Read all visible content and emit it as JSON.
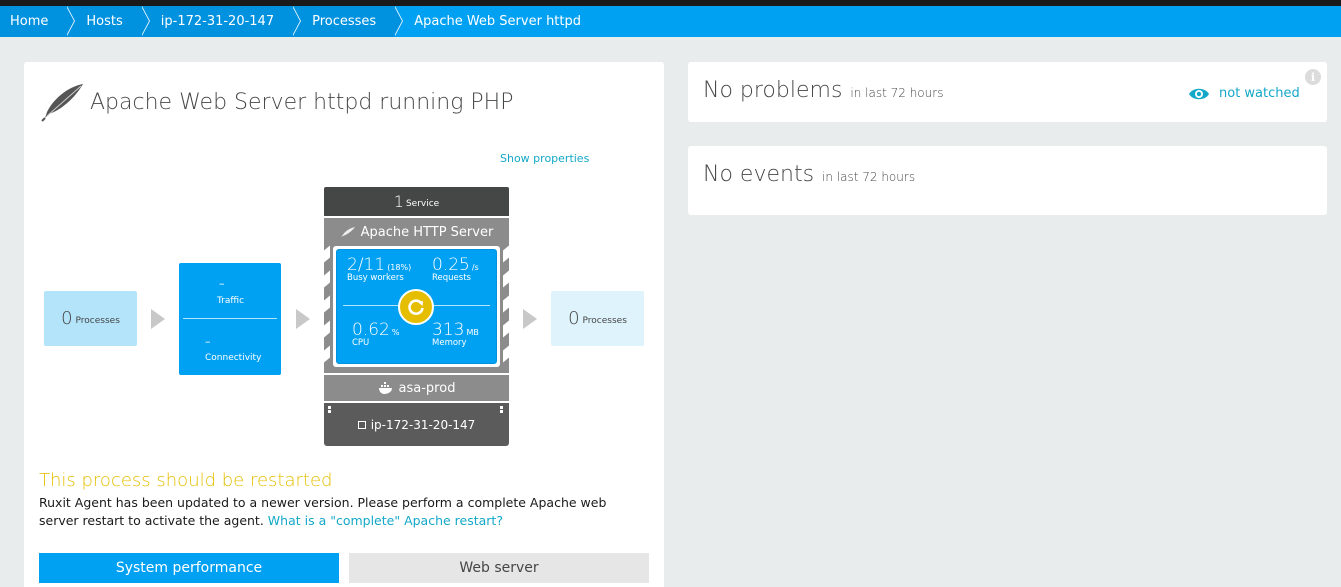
{
  "breadcrumb": [
    "Home",
    "Hosts",
    "ip-172-31-20-147",
    "Processes",
    "Apache Web Server httpd"
  ],
  "process": {
    "title": "Apache Web Server httpd running PHP",
    "icon": "feather-icon",
    "show_properties": "Show properties"
  },
  "flow": {
    "incoming": {
      "count": "0",
      "label": "Processes"
    },
    "connection": {
      "traffic_value": "–",
      "traffic_label": "Traffic",
      "connectivity_value": "–",
      "connectivity_label": "Connectivity"
    },
    "outgoing": {
      "count": "0",
      "label": "Processes"
    }
  },
  "service": {
    "count": "1",
    "count_label": "Service",
    "name": "Apache HTTP Server",
    "metrics": {
      "busy_workers": {
        "value": "2/11",
        "unit": "(18%)",
        "label": "Busy workers"
      },
      "requests": {
        "value": "0.25",
        "unit": "/s",
        "label": "Requests"
      },
      "cpu": {
        "value": "0.62",
        "unit": "%",
        "label": "CPU"
      },
      "memory": {
        "value": "313",
        "unit": "MB",
        "label": "Memory"
      }
    },
    "group": "asa-prod",
    "host": "ip-172-31-20-147"
  },
  "warning": {
    "title": "This process should be restarted",
    "text": "Ruxit Agent has been updated to a newer version. Please perform a complete Apache web server restart to activate the agent.",
    "link": "What is a \"complete\" Apache restart?"
  },
  "tabs": {
    "system_performance": "System performance",
    "web_server": "Web server"
  },
  "problems": {
    "title": "No problems",
    "period": "in last 72 hours",
    "watch_label": "not watched"
  },
  "events": {
    "title": "No events",
    "period": "in last 72 hours"
  },
  "colors": {
    "accent": "#00a1f3",
    "warning": "#e5be01",
    "link": "#14a8c8"
  }
}
